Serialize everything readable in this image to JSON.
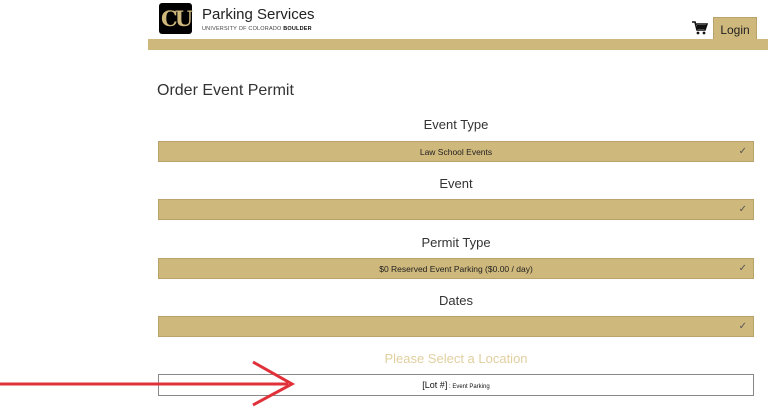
{
  "header": {
    "brand_title": "Parking Services",
    "brand_sub_prefix": "UNIVERSITY OF COLORADO ",
    "brand_sub_bold": "BOULDER",
    "logo_text": "CU",
    "cart_icon": "cart-icon",
    "login_label": "Login"
  },
  "colors": {
    "gold": "#cfb87c",
    "arrow": "#e0303a",
    "placeholder_gold": "#e0cf9f"
  },
  "page_title": "Order Event Permit",
  "form": {
    "event_type_label": "Event Type",
    "event_type_value": "Law School Events",
    "event_label": "Event",
    "event_value": "",
    "permit_type_label": "Permit Type",
    "permit_type_value": "$0 Reserved Event Parking ($0.00 / day)",
    "dates_label": "Dates",
    "dates_value": "",
    "check_glyph": "✓",
    "location_label": "Please Select a Location",
    "location_value_main": "[Lot #]",
    "location_value_sub": " : Event Parking"
  }
}
